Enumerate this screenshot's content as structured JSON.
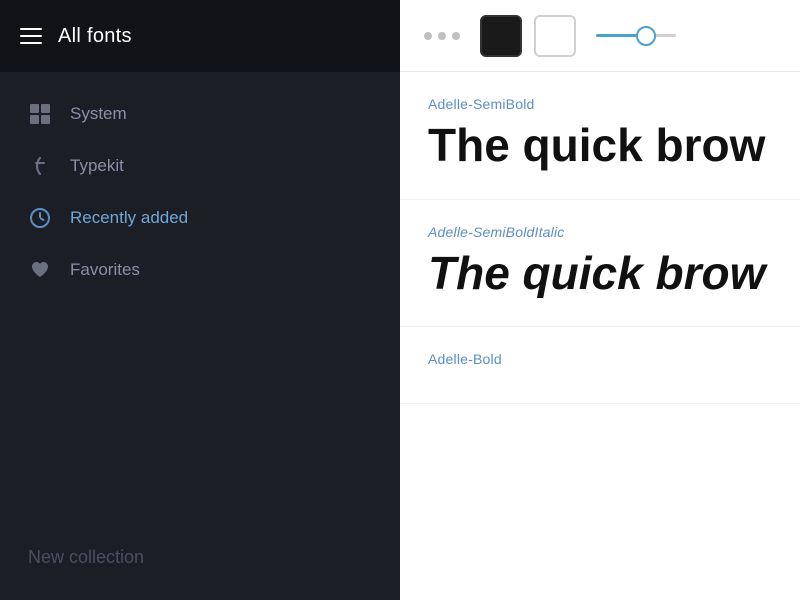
{
  "sidebar": {
    "header": {
      "title": "All fonts"
    },
    "nav_items": [
      {
        "id": "system",
        "label": "System",
        "icon": "system-grid-icon"
      },
      {
        "id": "typekit",
        "label": "Typekit",
        "icon": "typekit-icon"
      },
      {
        "id": "recently-added",
        "label": "Recently added",
        "icon": "clock-icon",
        "active": true
      },
      {
        "id": "favorites",
        "label": "Favorites",
        "icon": "heart-icon"
      }
    ],
    "new_collection_label": "New collection"
  },
  "toolbar": {
    "dots_count": 3,
    "slider_value": 65
  },
  "fonts": [
    {
      "name": "Adelle-SemiBold",
      "preview": "The quick brow",
      "style": "semibold",
      "italic": false
    },
    {
      "name": "Adelle-SemiBoldItalic",
      "preview": "The quick brow",
      "style": "semibold-italic",
      "italic": true
    },
    {
      "name": "Adelle-Bold",
      "preview": "",
      "style": "bold",
      "italic": false
    }
  ]
}
